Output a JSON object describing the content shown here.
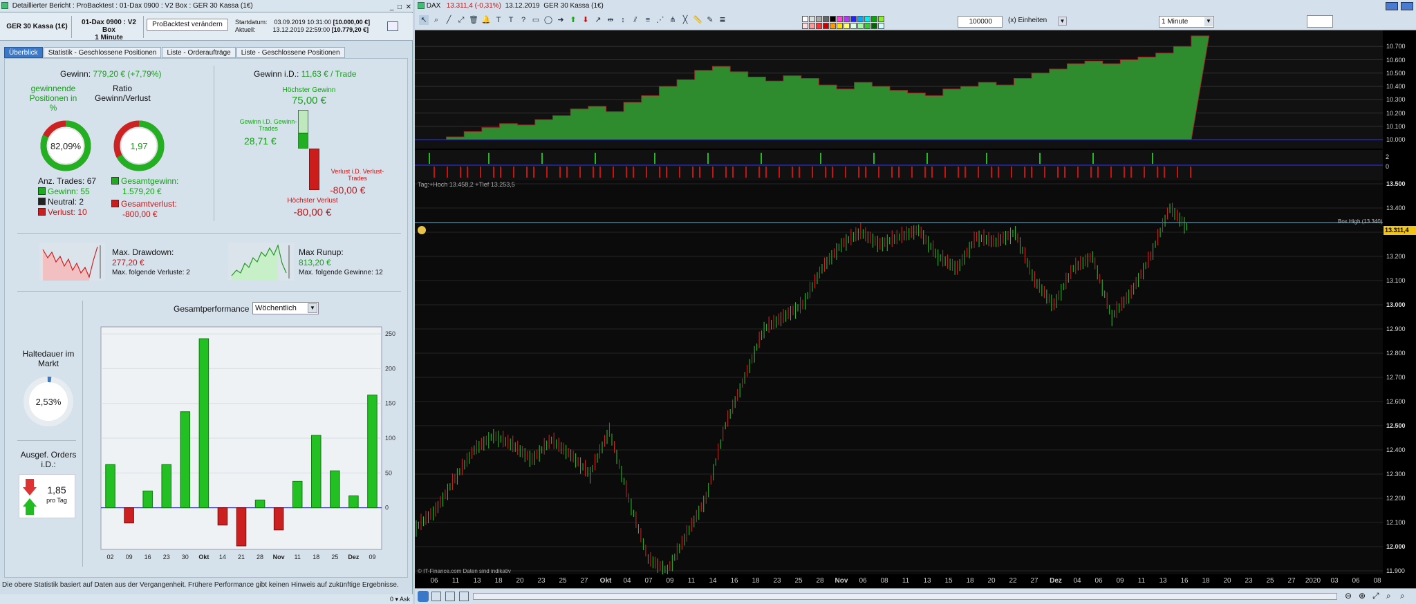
{
  "window": {
    "title": "Detaillierter Bericht : ProBacktest : 01-Dax 0900 : V2 Box : GER 30 Kassa (1€)"
  },
  "instrument_bar": {
    "instrument": "GER 30 Kassa (1€)",
    "strategy": "01-Dax 0900 : V2 Box",
    "timeframe": "1 Minute",
    "button": "ProBacktest verändern",
    "start_label": "Startdatum:",
    "start_value": "03.09.2019 10:31:00",
    "start_capital": "[10.000,00 €]",
    "current_label": "Aktuell:",
    "current_value": "13.12.2019 22:59:00",
    "current_capital": "[10.779,20 €]"
  },
  "tabs": [
    "Überblick",
    "Statistik - Geschlossene Positionen",
    "Liste - Orderaufträge",
    "Liste - Geschlossene Positionen"
  ],
  "overview": {
    "gewinn_label": "Gewinn:",
    "gewinn_value": "779,20 € (+7,79%)",
    "win_pct_label": "gewinnende Positionen in %",
    "win_pct_value": "82,09%",
    "win_pct_fraction": 0.8209,
    "ratio_label": "Ratio Gewinn/Verlust",
    "ratio_value": "1,97",
    "trades_label": "Anz. Trades: 67",
    "gewinn_count": "Gewinn: 55",
    "neutral_count": "Neutral: 2",
    "verlust_count": "Verlust: 10",
    "gesamtgewinn_label": "Gesamtgewinn:",
    "gesamtgewinn_value": "1.579,20 €",
    "gesamtverlust_label": "Gesamtverlust:",
    "gesamtverlust_value": "-800,00 €",
    "gewinn_id_label": "Gewinn i.D.:",
    "gewinn_id_value": "11,63 € / Trade",
    "hoechster_gewinn_label": "Höchster Gewinn",
    "hoechster_gewinn_value": "75,00 €",
    "avg_gewinn_label": "Gewinn i.D. Gewinn-Trades",
    "avg_gewinn_value": "28,71 €",
    "avg_verlust_label": "Verlust i.D. Verlust-Trades",
    "avg_verlust_value": "-80,00 €",
    "hoechster_verlust_label": "Höchster Verlust",
    "hoechster_verlust_value": "-80,00 €",
    "drawdown_label": "Max. Drawdown:",
    "drawdown_value": "277,20 €",
    "drawdown_sub": "Max. folgende Verluste: 2",
    "runup_label": "Max Runup:",
    "runup_value": "813,20 €",
    "runup_sub": "Max. folgende Gewinne: 12",
    "haltedauer_label": "Haltedauer im Markt",
    "haltedauer_value": "2,53%",
    "orders_label": "Ausgef. Orders i.D.:",
    "orders_value": "1,85",
    "orders_unit": "pro Tag",
    "perf_label": "Gesamtperformance",
    "perf_select": "Wöchentlich"
  },
  "chart_data": [
    {
      "type": "bar",
      "title": "Gesamtperformance",
      "categories": [
        "02",
        "09",
        "16",
        "23",
        "30",
        "Okt",
        "14",
        "21",
        "28",
        "Nov",
        "11",
        "18",
        "25",
        "Dez",
        "09"
      ],
      "values": [
        62,
        -22,
        24,
        62,
        138,
        243,
        -25,
        -55,
        11,
        -32,
        38,
        104,
        53,
        17,
        162
      ],
      "ylim": [
        -60,
        260
      ],
      "yticks": [
        0,
        50,
        100,
        150,
        200,
        250
      ]
    },
    {
      "type": "area",
      "title": "Equity",
      "ylim": [
        10000,
        10800
      ],
      "yticks": [
        "10.000",
        "10.100",
        "10.200",
        "10.300",
        "10.400",
        "10.500",
        "10.600",
        "10.700"
      ],
      "values": [
        10000,
        10020,
        10060,
        10090,
        10120,
        10110,
        10150,
        10180,
        10230,
        10250,
        10210,
        10280,
        10330,
        10400,
        10450,
        10520,
        10550,
        10510,
        10470,
        10440,
        10480,
        10460,
        10410,
        10380,
        10430,
        10400,
        10370,
        10350,
        10330,
        10380,
        10400,
        10430,
        10410,
        10460,
        10500,
        10530,
        10570,
        10590,
        10570,
        10600,
        10620,
        10650,
        10700,
        10779
      ]
    },
    {
      "type": "line",
      "title": "DAX",
      "ylim": [
        11900,
        13500
      ],
      "yticks": [
        "11.900",
        "12.000",
        "12.100",
        "12.200",
        "12.300",
        "12.400",
        "12.500",
        "12.600",
        "12.700",
        "12.800",
        "12.900",
        "13.000",
        "13.100",
        "13.200",
        "13.300",
        "13.400",
        "13.500"
      ],
      "x": [
        "06",
        "11",
        "13",
        "18",
        "20",
        "23",
        "25",
        "27",
        "Okt",
        "04",
        "07",
        "09",
        "11",
        "14",
        "16",
        "18",
        "23",
        "25",
        "28",
        "Nov",
        "06",
        "08",
        "11",
        "13",
        "15",
        "18",
        "20",
        "22",
        "27",
        "Dez",
        "04",
        "06",
        "09",
        "11",
        "13",
        "16",
        "18",
        "20",
        "23",
        "25",
        "27",
        "2020",
        "03",
        "06",
        "08"
      ],
      "series_points": [
        12080,
        12150,
        12280,
        12400,
        12460,
        12420,
        12360,
        12440,
        12380,
        12300,
        12480,
        12200,
        11950,
        11900,
        12050,
        12200,
        12500,
        12700,
        12900,
        12950,
        13000,
        13150,
        13250,
        13300,
        13250,
        13280,
        13310,
        13200,
        13150,
        13280,
        13260,
        13300,
        13100,
        13000,
        13150,
        13200,
        12950,
        13050,
        13200,
        13400,
        13311
      ],
      "box_high": "Box High (13.340)",
      "box_high_value": 13340,
      "current_price": "13.311,4"
    }
  ],
  "chart_panel": {
    "price_label": "DAX",
    "price_value": "13.311,4 (-0,31%)",
    "date": "13.12.2019",
    "instrument": "GER 30 Kassa (1€)",
    "units_value": "100000",
    "units_label": "(x) Einheiten",
    "timeframe": "1 Minute",
    "info_line": "Tag:+Hoch 13.458,2 +Tief 13.253,5",
    "credit": "© IT-Finance.com  Daten sind indikativ",
    "sig_axis_top": "2",
    "sig_axis_bottom": "0"
  },
  "status": {
    "text": "Die obere Statistik basiert auf Daten aus der Vergangenheit. Frühere Performance gibt keinen Hinweis auf zukünftige Ergebnisse.",
    "bottom_left": "0 ▾ Ask"
  },
  "colors": {
    "accent": "#3b79c8",
    "win": "#1faa1f",
    "loss": "#cc1d1d",
    "equity": "#2e8b2e"
  }
}
